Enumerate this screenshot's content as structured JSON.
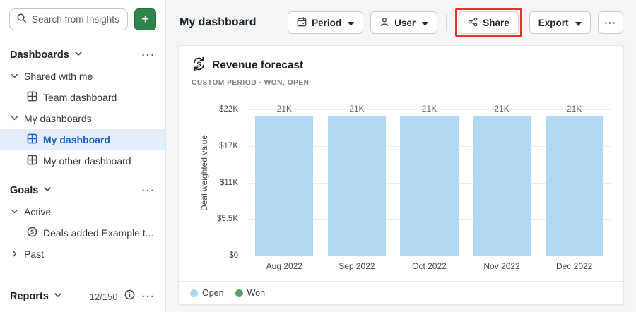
{
  "colors": {
    "accent_green": "#2e8549",
    "bar_open_blue": "#b0d8f3",
    "won_green": "#5aa264",
    "selected_blue": "#1c66cc",
    "annotation_red": "#e5342b"
  },
  "sidebar": {
    "search_placeholder": "Search from Insights",
    "add_button": "+",
    "ellipsis": "···",
    "dashboards": {
      "title": "Dashboards",
      "shared_group": "Shared with me",
      "team_dashboard": "Team dashboard",
      "my_group": "My dashboards",
      "my_dashboard": "My dashboard",
      "my_other_dashboard": "My other dashboard"
    },
    "goals": {
      "title": "Goals",
      "active_group": "Active",
      "deals_item": "Deals added Example t...",
      "past_group": "Past"
    },
    "reports": {
      "title": "Reports",
      "count": "12/150"
    }
  },
  "header": {
    "title": "My dashboard",
    "period_button": "Period",
    "user_button": "User",
    "share_button": "Share",
    "export_button": "Export",
    "more_button": "···"
  },
  "chart_data": {
    "type": "bar",
    "title": "Revenue forecast",
    "subtitle": "CUSTOM PERIOD · WON, OPEN",
    "ylabel": "Deal weighted value",
    "categories": [
      "Aug 2022",
      "Sep 2022",
      "Oct 2022",
      "Nov 2022",
      "Dec 2022"
    ],
    "series": [
      {
        "name": "Open",
        "color": "#b0d8f3",
        "values": [
          21000,
          21000,
          21000,
          21000,
          21000
        ]
      },
      {
        "name": "Won",
        "color": "#5aa264",
        "values": [
          0,
          0,
          0,
          0,
          0
        ]
      }
    ],
    "bar_labels": [
      "21K",
      "21K",
      "21K",
      "21K",
      "21K"
    ],
    "ytick_labels": [
      "$22K",
      "$17K",
      "$11K",
      "$5.5K",
      "$0"
    ],
    "ylim": [
      0,
      22000
    ],
    "grid": true,
    "legend_position": "bottom"
  }
}
